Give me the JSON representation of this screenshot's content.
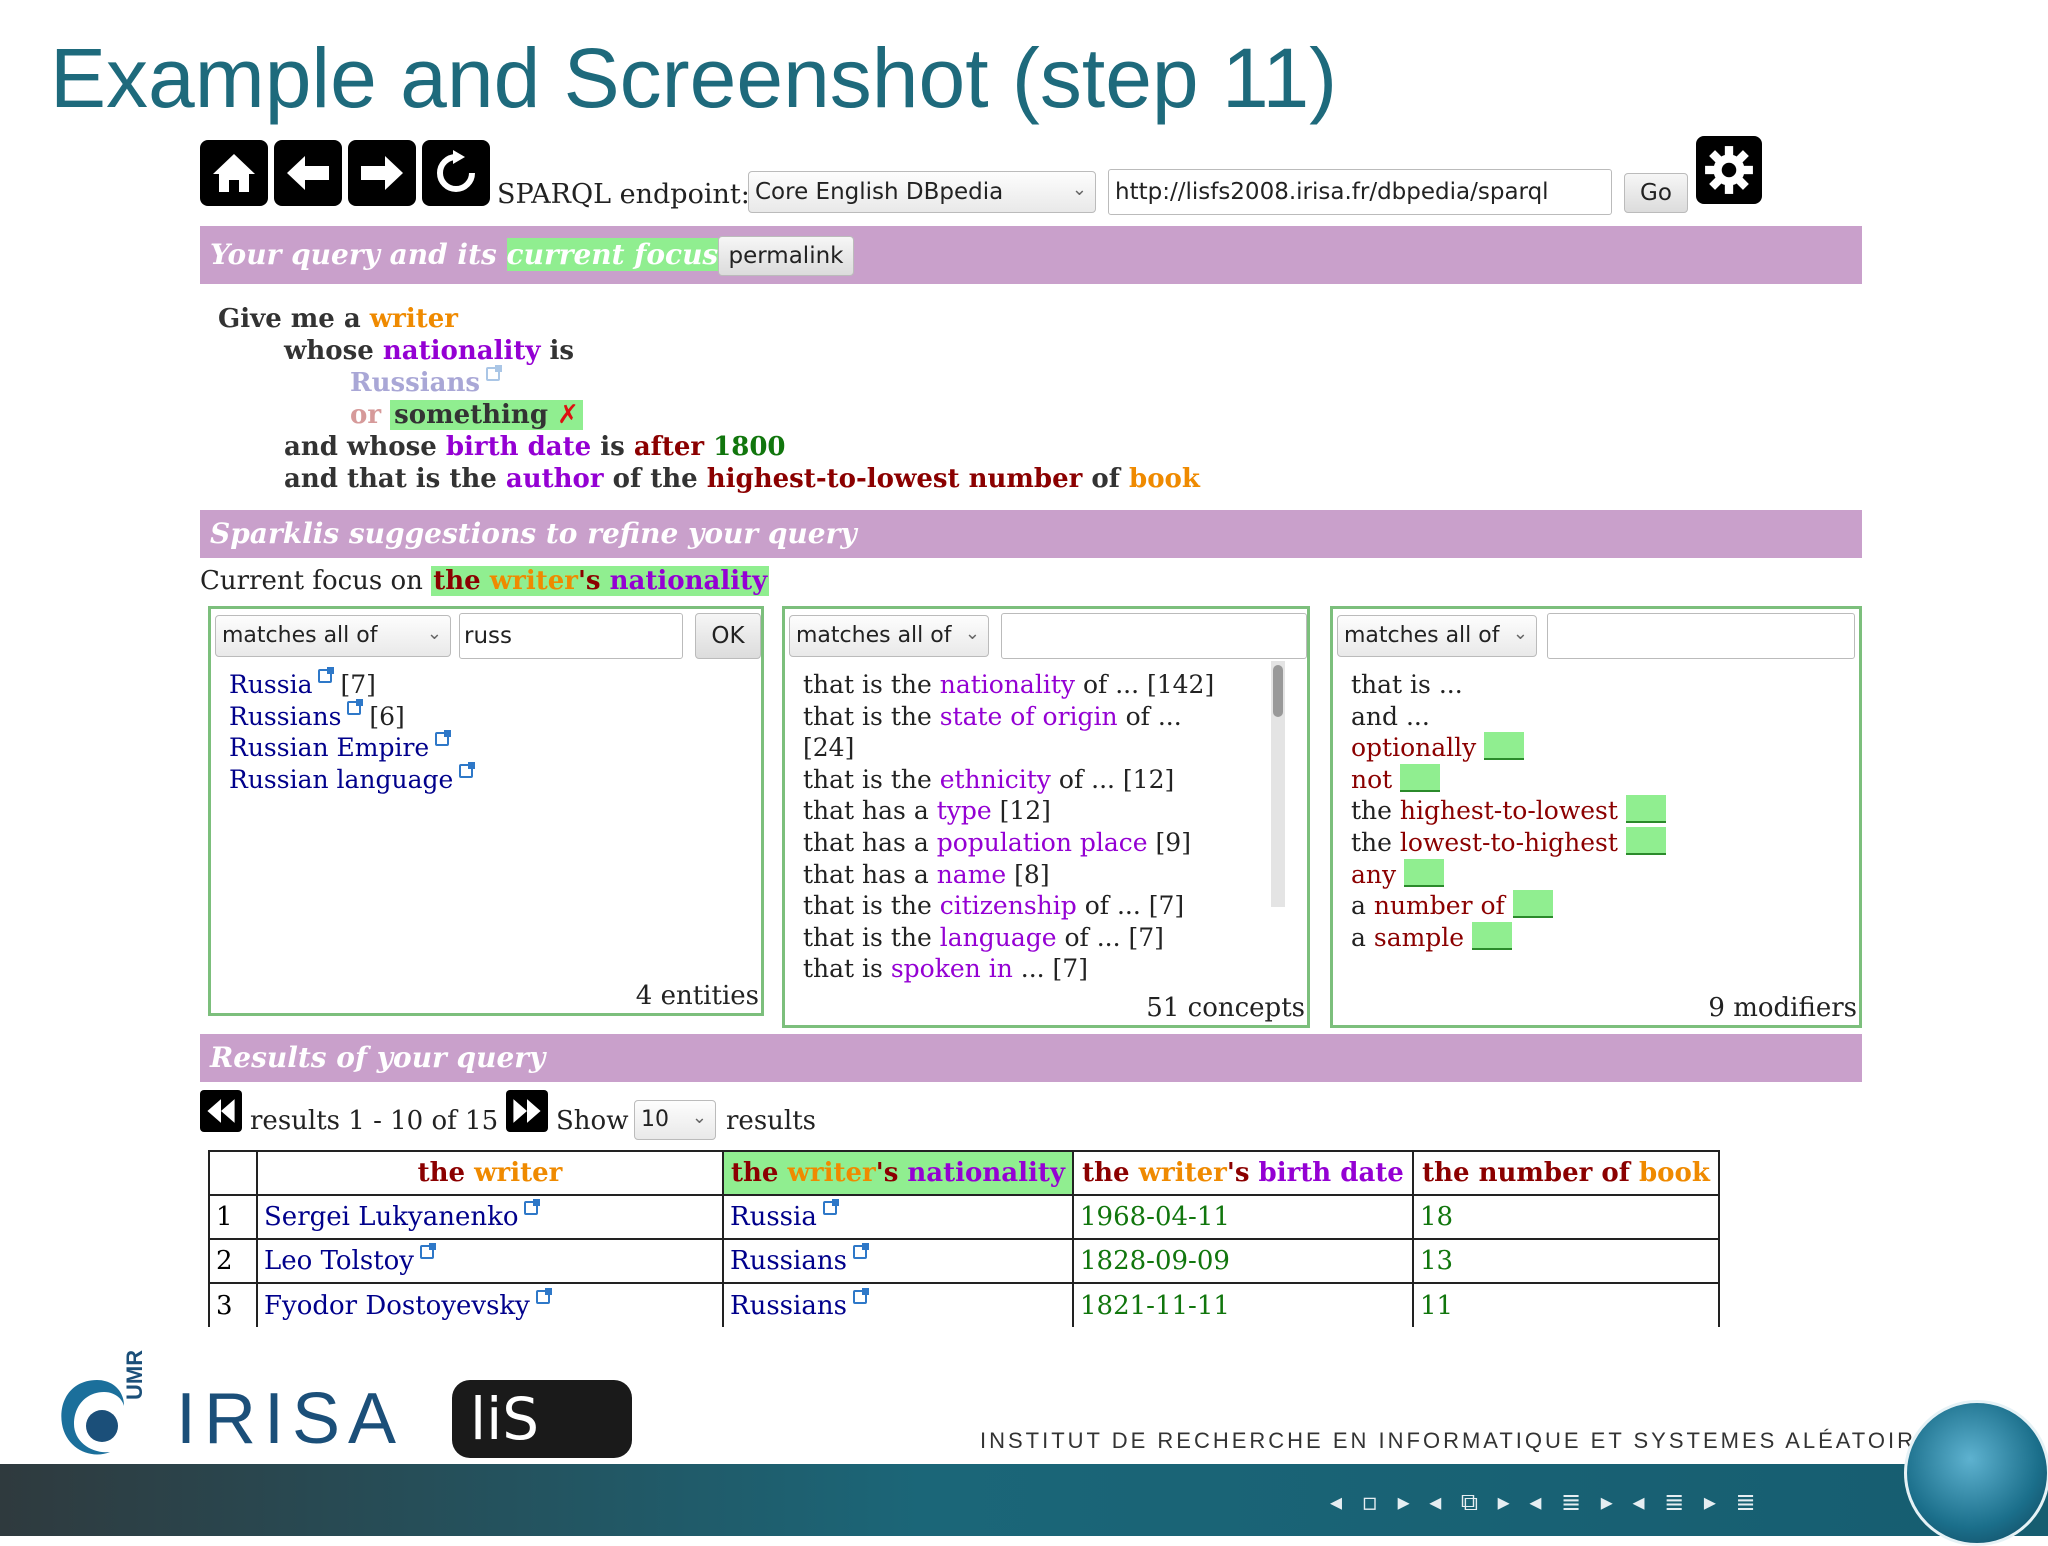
{
  "slide": {
    "title": "Example and Screenshot (step 11)"
  },
  "toolbar": {
    "endpoint_label": "SPARQL endpoint:",
    "endpoint_selected": "Core English DBpedia",
    "endpoint_url": "http://lisfs2008.irisa.fr/dbpedia/sparql",
    "go_label": "Go",
    "icons": [
      "home-icon",
      "back-arrow-icon",
      "forward-arrow-icon",
      "refresh-icon",
      "gear-icon"
    ]
  },
  "query_section": {
    "bar_text": "Your query and its",
    "bar_focus": "current focus",
    "permalink_label": "permalink",
    "lines": {
      "l1_a": "Give me a",
      "l1_writer": "writer",
      "l2_whose": "whose",
      "l2_nationality": "nationality",
      "l2_is": "is",
      "l3_russians": "Russians",
      "l4_or": "or",
      "l4_something": "something",
      "l4_delete": "✗",
      "l5_a": "and whose",
      "l5_birthdate": "birth date",
      "l5_is": "is",
      "l5_after": "after",
      "l5_value": "1800",
      "l6_a": "and that is the",
      "l6_author": "author",
      "l6_of": "of the",
      "l6_highest": "highest-to-lowest",
      "l6_number": "number",
      "l6_of2": "of",
      "l6_book": "book"
    }
  },
  "suggestions": {
    "bar_text": "Sparklis suggestions to refine your query",
    "focus_prefix": "Current focus on",
    "focus_the": "the",
    "focus_writer": "writer",
    "focus_apos": "'s",
    "focus_nationality": "nationality",
    "entities": {
      "filter_mode": "matches all of",
      "filter_value": "russ",
      "ok_label": "OK",
      "items": [
        {
          "label": "Russia",
          "count": "[7]"
        },
        {
          "label": "Russians",
          "count": "[6]"
        },
        {
          "label": "Russian Empire",
          "count": ""
        },
        {
          "label": "Russian language",
          "count": ""
        }
      ],
      "count_text": "4 entities"
    },
    "concepts": {
      "filter_mode": "matches all of",
      "filter_value": "",
      "items": [
        {
          "pre": "that is the",
          "concept": "nationality",
          "post": "of ... [142]"
        },
        {
          "pre": "that is the",
          "concept": "state of origin",
          "post": "of ..."
        },
        {
          "pre": "[24]",
          "concept": "",
          "post": ""
        },
        {
          "pre": "that is the",
          "concept": "ethnicity",
          "post": "of ... [12]"
        },
        {
          "pre": "that has a",
          "concept": "type",
          "post": "[12]"
        },
        {
          "pre": "that has a",
          "concept": "population place",
          "post": "[9]"
        },
        {
          "pre": "that has a",
          "concept": "name",
          "post": "[8]"
        },
        {
          "pre": "that is the",
          "concept": "citizenship",
          "post": "of ... [7]"
        },
        {
          "pre": "that is the",
          "concept": "language",
          "post": "of ... [7]"
        },
        {
          "pre": "that is",
          "concept": "spoken in",
          "post": "... [7]"
        }
      ],
      "count_text": "51 concepts"
    },
    "modifiers": {
      "filter_mode": "matches all of",
      "filter_value": "",
      "items": [
        {
          "pre": "that is ...",
          "mod": "",
          "slot": false
        },
        {
          "pre": "and ...",
          "mod": "",
          "slot": false
        },
        {
          "pre": "",
          "mod": "optionally",
          "slot": true
        },
        {
          "pre": "",
          "mod": "not",
          "slot": true
        },
        {
          "pre": "the",
          "mod": "highest-to-lowest",
          "slot": true
        },
        {
          "pre": "the",
          "mod": "lowest-to-highest",
          "slot": true
        },
        {
          "pre": "",
          "mod": "any",
          "slot": true
        },
        {
          "pre": "a",
          "mod": "number of",
          "slot": true
        },
        {
          "pre": "a",
          "mod": "sample",
          "slot": true
        }
      ],
      "count_text": "9 modifiers"
    }
  },
  "results": {
    "bar_text": "Results of your query",
    "range_text": "results 1 - 10 of 15",
    "show_label": "Show",
    "page_size": "10",
    "results_label": "results",
    "columns": {
      "writer": {
        "the": "the",
        "writer": "writer"
      },
      "nationality": {
        "the": "the",
        "writer": "writer",
        "apos": "'s",
        "nationality": "nationality"
      },
      "birthdate": {
        "the": "the",
        "writer": "writer",
        "apos": "'s",
        "birthdate": "birth date"
      },
      "number": {
        "the": "the number of",
        "book": "book"
      }
    },
    "rows": [
      {
        "index": "1",
        "writer": "Sergei Lukyanenko",
        "nationality": "Russia",
        "birth_date": "1968-04-11",
        "books": "18"
      },
      {
        "index": "2",
        "writer": "Leo Tolstoy",
        "nationality": "Russians",
        "birth_date": "1828-09-09",
        "books": "13"
      },
      {
        "index": "3",
        "writer": "Fyodor Dostoyevsky",
        "nationality": "Russians",
        "birth_date": "1821-11-11",
        "books": "11"
      }
    ]
  },
  "footer": {
    "umr": "UMR",
    "irisa": "IRISA",
    "lis": "liS",
    "institute": "INSTITUT DE RECHERCHE EN INFORMATIQUE ET SYSTEMES ALÉATOIRES",
    "nav_glyphs": "◂ ▫ ▸ ◂ ⧉ ▸ ◂ ≣ ▸ ◂ ≣ ▸ ≣"
  }
}
